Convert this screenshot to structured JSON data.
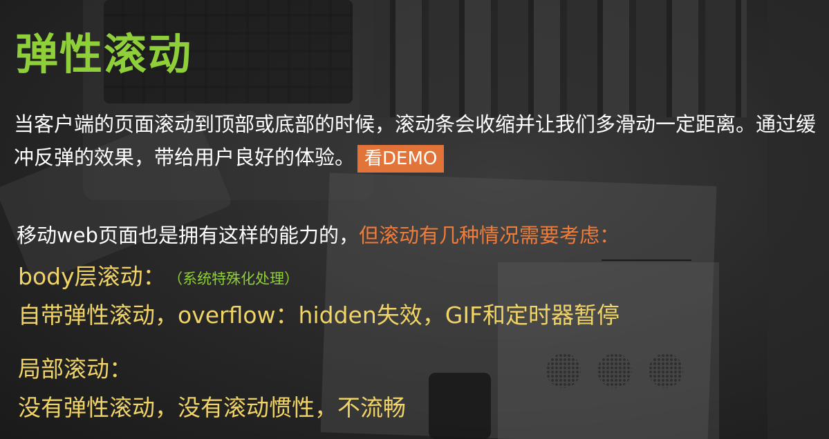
{
  "title": "弹性滚动",
  "intro": {
    "text": "当客户端的页面滚动到顶部或底部的时候，滚动条会收缩并让我们多滑动一定距离。通过缓冲反弹的效果，带给用户良好的体验。",
    "demo_label": "看DEMO"
  },
  "mobile": {
    "text": "移动web页面也是拥有这样的能力的，",
    "highlight": "但滚动有几种情况需要考虑："
  },
  "body_scroll": {
    "heading": "body层滚动：",
    "note": "（系统特殊化处理）",
    "description": "自带弹性滚动，overflow：hidden失效，GIF和定时器暂停"
  },
  "local_scroll": {
    "heading": "局部滚动：",
    "description": "没有弹性滚动，没有滚动惯性，不流畅"
  },
  "colors": {
    "title": "#8fcf3a",
    "highlight": "#f07c3a",
    "emphasis": "#f0d468",
    "demo_button": "#e2743a"
  }
}
